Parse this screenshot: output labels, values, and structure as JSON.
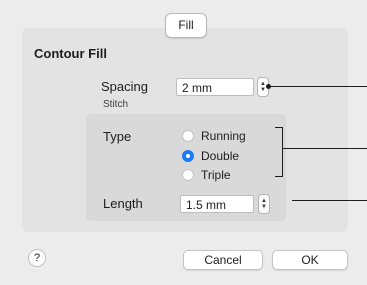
{
  "tab": {
    "label": "Fill"
  },
  "contour_fill": {
    "title": "Contour Fill",
    "spacing": {
      "label": "Spacing",
      "value": "2 mm"
    },
    "stitch": {
      "title": "Stitch",
      "type": {
        "label": "Type",
        "options": [
          {
            "label": "Running",
            "selected": false
          },
          {
            "label": "Double",
            "selected": true
          },
          {
            "label": "Triple",
            "selected": false
          }
        ]
      },
      "length": {
        "label": "Length",
        "value": "1.5 mm"
      }
    }
  },
  "footer": {
    "help_label": "?",
    "cancel_label": "Cancel",
    "ok_label": "OK"
  },
  "colors": {
    "accent": "#1b7cf3",
    "dialog_bg": "#ececec"
  },
  "icons": {
    "stepper": "up-down-chevrons-icon",
    "help": "question-mark-icon"
  }
}
